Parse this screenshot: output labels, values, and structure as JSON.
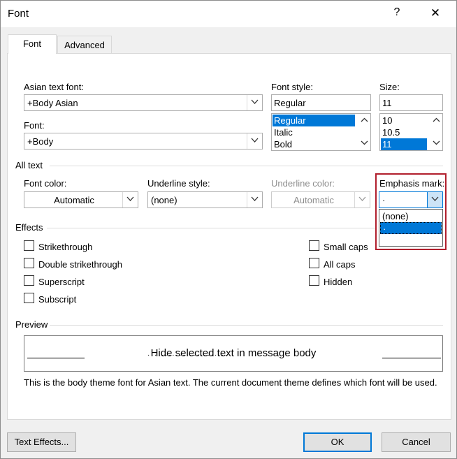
{
  "window": {
    "title": "Font",
    "help_label": "?",
    "close_label": "✕"
  },
  "tabs": [
    {
      "label": "Font",
      "active": true
    },
    {
      "label": "Advanced",
      "active": false
    }
  ],
  "labels": {
    "asian_text_font": "Asian text font:",
    "font": "Font:",
    "font_style": "Font style:",
    "size": "Size:",
    "font_color": "Font color:",
    "underline_style": "Underline style:",
    "underline_color": "Underline color:",
    "emphasis_mark": "Emphasis mark:"
  },
  "fields": {
    "asian_text_font_value": "+Body Asian",
    "font_value": "+Body",
    "font_style_value": "Regular",
    "size_value": "11",
    "font_color_value": "Automatic",
    "underline_style_value": "(none)",
    "underline_color_value": "Automatic",
    "emphasis_mark_value": "·"
  },
  "font_style_list": [
    "Regular",
    "Italic",
    "Bold"
  ],
  "font_style_selected": "Regular",
  "size_list": [
    "10",
    "10.5",
    "11"
  ],
  "size_selected": "11",
  "emphasis_dropdown": [
    "(none)",
    "·",
    ""
  ],
  "groups": {
    "all_text": "All text",
    "effects": "Effects",
    "preview": "Preview"
  },
  "effects": {
    "strikethrough": {
      "label": "Strikethrough",
      "checked": false
    },
    "double_strikethrough": {
      "label": "Double strikethrough",
      "checked": false
    },
    "superscript": {
      "label": "Superscript",
      "checked": false
    },
    "subscript": {
      "label": "Subscript",
      "checked": false
    },
    "small_caps": {
      "label": "Small caps",
      "checked": false
    },
    "all_caps": {
      "label": "All caps",
      "checked": false
    },
    "hidden": {
      "label": "Hidden",
      "checked": false
    }
  },
  "preview": {
    "sample_text": "Hide selected text in message body",
    "emphasis_dots": "·······················",
    "description": "This is the body theme font for Asian text. The current document theme defines which font will be used."
  },
  "buttons": {
    "text_effects": "Text Effects...",
    "ok": "OK",
    "cancel": "Cancel"
  },
  "colors": {
    "selection": "#0078d7",
    "highlight_border": "#b11f2d",
    "dialog_bg": "#f0f0f0"
  }
}
